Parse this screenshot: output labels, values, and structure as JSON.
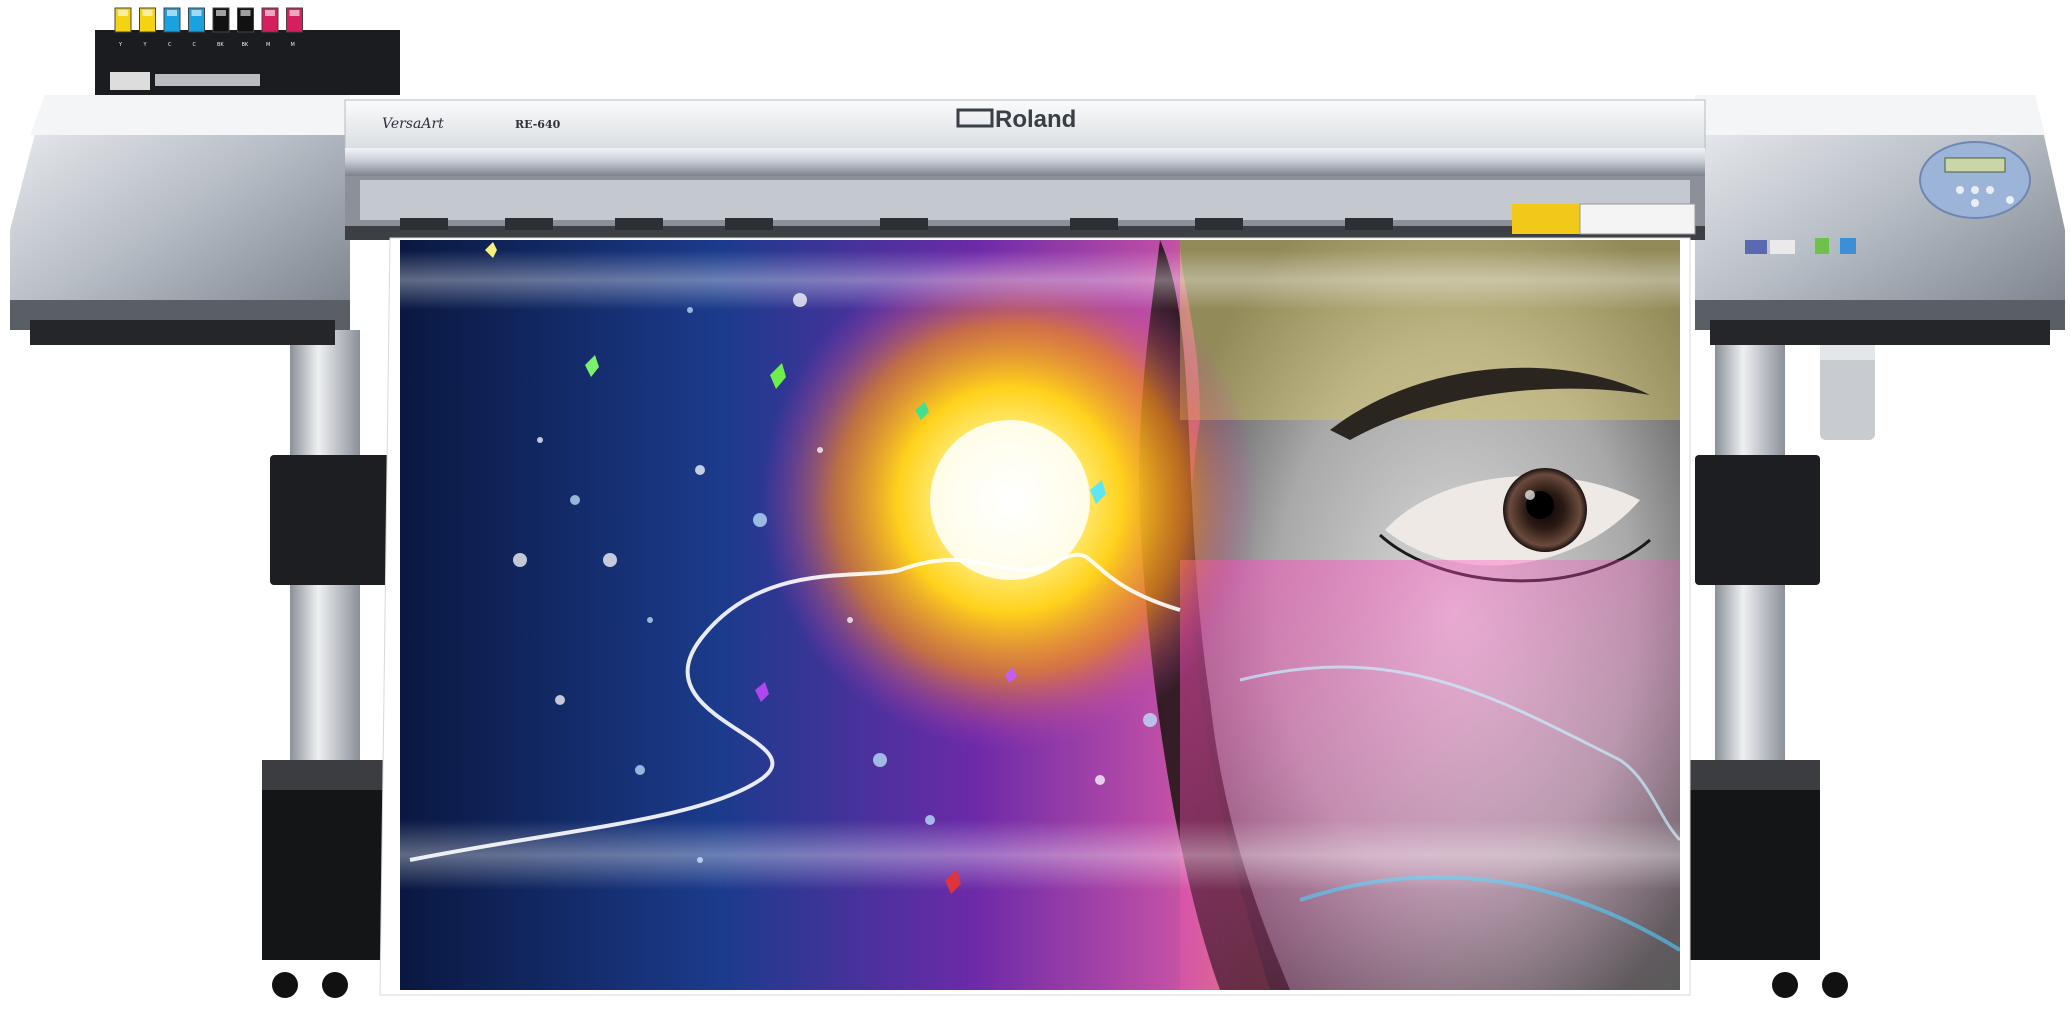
{
  "product": {
    "brand": "Roland",
    "model_script": "VersaArt",
    "model_number": "RE-640"
  },
  "ink_cartridges": [
    {
      "color": "#f6d312",
      "label": "Y"
    },
    {
      "color": "#f6d312",
      "label": "Y"
    },
    {
      "color": "#1aa2e0",
      "label": "C"
    },
    {
      "color": "#1aa2e0",
      "label": "C"
    },
    {
      "color": "#111111",
      "label": "BK"
    },
    {
      "color": "#111111",
      "label": "BK"
    },
    {
      "color": "#d51f5e",
      "label": "M"
    },
    {
      "color": "#d51f5e",
      "label": "M"
    }
  ],
  "colors": {
    "body_silver": "#c7ccd3",
    "body_dark": "#5d6169",
    "panel_blue": "#9db4d9"
  }
}
